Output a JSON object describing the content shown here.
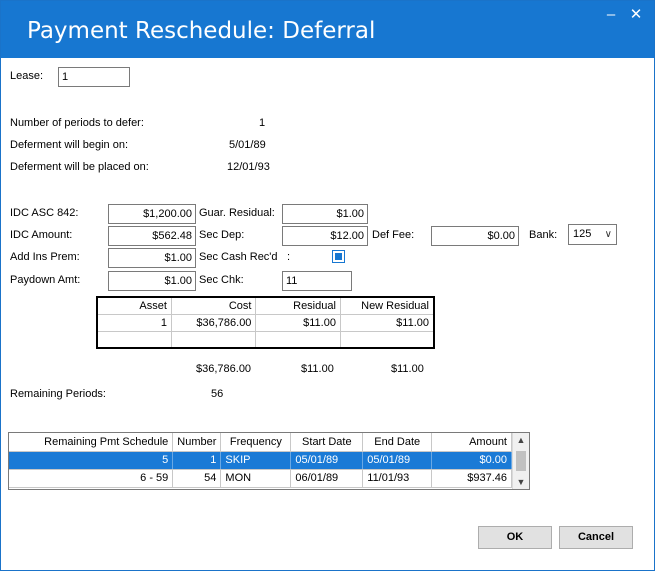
{
  "window": {
    "title": "Payment Reschedule: Deferral",
    "minimize_glyph": "–",
    "close_glyph": "✕"
  },
  "lease": {
    "label": "Lease:",
    "value": "1"
  },
  "periods": {
    "defer_label": "Number of periods to defer:",
    "defer_value": "1",
    "begin_label": "Deferment will begin on:",
    "begin_value": "5/01/89",
    "placed_label": "Deferment will be placed on:",
    "placed_value": "12/01/93"
  },
  "fields": {
    "idc_asc_label": "IDC ASC 842:",
    "idc_asc_value": "$1,200.00",
    "idc_amount_label": "IDC Amount:",
    "idc_amount_value": "$562.48",
    "add_ins_label": "Add Ins Prem:",
    "add_ins_value": "$1.00",
    "paydown_label": "Paydown Amt:",
    "paydown_value": "$1.00",
    "guar_residual_label": "Guar. Residual:",
    "guar_residual_value": "$1.00",
    "sec_dep_label": "Sec Dep:",
    "sec_dep_value": "$12.00",
    "sec_cash_label": "Sec Cash Rec'd",
    "sec_cash_colon": ":",
    "sec_chk_label": "Sec Chk:",
    "sec_chk_value": "11",
    "def_fee_label": "Def Fee:",
    "def_fee_value": "$0.00",
    "bank_label": "Bank:",
    "bank_value": "125"
  },
  "asset_table": {
    "headers": [
      "Asset",
      "Cost",
      "Residual",
      "New Residual"
    ],
    "rows": [
      [
        "1",
        "$36,786.00",
        "$11.00",
        "$11.00"
      ]
    ]
  },
  "totals": {
    "cost": "$36,786.00",
    "residual": "$11.00",
    "new_residual": "$11.00"
  },
  "remaining": {
    "label": "Remaining Periods:",
    "value": "56"
  },
  "pmt_table": {
    "headers": [
      "Remaining Pmt Schedule",
      "Number",
      "Frequency",
      "Start Date",
      "End Date",
      "Amount"
    ],
    "rows": [
      [
        "5",
        "1",
        "SKIP",
        "05/01/89",
        "05/01/89",
        "$0.00"
      ],
      [
        "6  -  59",
        "54",
        "MON",
        "06/01/89",
        "11/01/93",
        "$937.46"
      ]
    ]
  },
  "buttons": {
    "ok": "OK",
    "cancel": "Cancel"
  },
  "icons": {
    "chevron": "∨",
    "scroll_up": "▲",
    "scroll_down": "▼"
  },
  "colors": {
    "titlebar": "#1777d1",
    "selection": "#1a7ad6"
  }
}
